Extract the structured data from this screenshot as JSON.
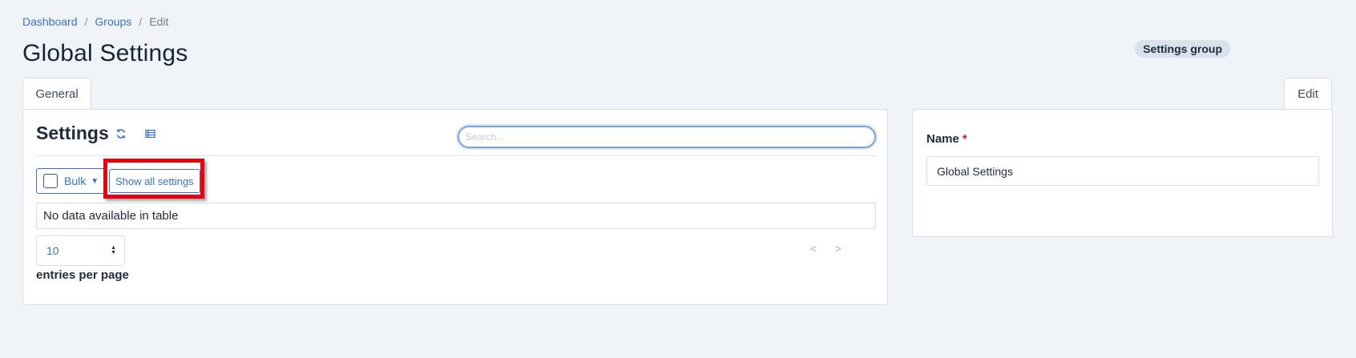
{
  "breadcrumb": {
    "items": [
      "Dashboard",
      "Groups"
    ],
    "current": "Edit",
    "separator": "/"
  },
  "page": {
    "title": "Global Settings",
    "badge": "Settings group"
  },
  "tabs": {
    "left": "General",
    "right": "Edit"
  },
  "settings_panel": {
    "title": "Settings",
    "search_placeholder": "Search...",
    "bulk_label": "Bulk",
    "show_all_label": "Show all settings",
    "empty_message": "No data available in table",
    "per_page_value": "10",
    "per_page_label": "entries per page",
    "prev": "<",
    "next": ">",
    "icons": [
      "refresh-icon",
      "table-icon",
      "caret-down-icon",
      "sort-arrows-icon"
    ]
  },
  "edit_panel": {
    "name_label": "Name",
    "required_mark": "*",
    "name_value": "Global Settings"
  },
  "colors": {
    "accent": "#3a72c7",
    "background": "#f0f3f7",
    "highlight": "#e8000d",
    "required": "#d11a1a"
  }
}
